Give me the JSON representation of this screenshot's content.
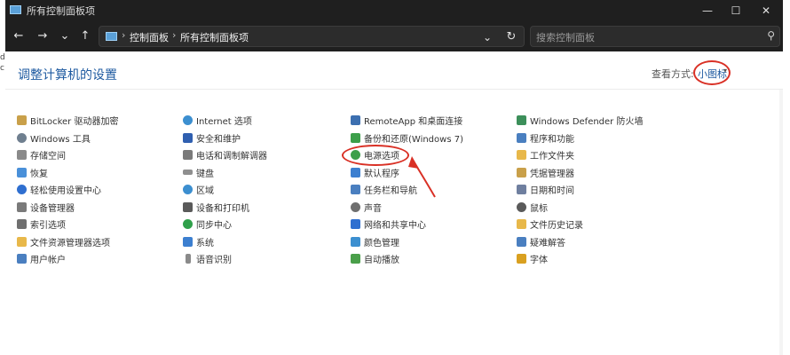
{
  "window": {
    "title": "所有控制面板项"
  },
  "titlebar": {
    "minimize": "—",
    "maximize": "☐",
    "close": "✕"
  },
  "nav": {
    "back": "←",
    "forward": "→",
    "recent": "⌄",
    "up": "↑",
    "dropdown": "⌄",
    "refresh": "↻"
  },
  "breadcrumb": {
    "sep": "›",
    "items": [
      "控制面板",
      "所有控制面板项"
    ]
  },
  "search": {
    "placeholder": "搜索控制面板",
    "icon": "⚲"
  },
  "content": {
    "title": "调整计算机的设置",
    "view_by_label": "查看方式:",
    "view_by_value": "小图标",
    "view_by_arrow": "▾"
  },
  "columns": [
    {
      "items": [
        {
          "label": "BitLocker 驱动器加密",
          "icon": "key-icon",
          "color": "#c9a04a"
        },
        {
          "label": "Windows 工具",
          "icon": "gear-icon",
          "color": "#6f7f8f"
        },
        {
          "label": "存储空间",
          "icon": "storage-icon",
          "color": "#8a8a8a"
        },
        {
          "label": "恢复",
          "icon": "recovery-icon",
          "color": "#4a90d9"
        },
        {
          "label": "轻松使用设置中心",
          "icon": "accessibility-icon",
          "color": "#2f6fd0"
        },
        {
          "label": "设备管理器",
          "icon": "device-manager-icon",
          "color": "#7a7a7a"
        },
        {
          "label": "索引选项",
          "icon": "index-icon",
          "color": "#6f6f6f"
        },
        {
          "label": "文件资源管理器选项",
          "icon": "folder-icon",
          "color": "#e8b84a"
        },
        {
          "label": "用户帐户",
          "icon": "users-icon",
          "color": "#4a7fc0"
        }
      ]
    },
    {
      "items": [
        {
          "label": "Internet 选项",
          "icon": "globe-icon",
          "color": "#3c8fd0"
        },
        {
          "label": "安全和维护",
          "icon": "flag-icon",
          "color": "#2f5fb0"
        },
        {
          "label": "电话和调制解调器",
          "icon": "phone-icon",
          "color": "#7a7a7a"
        },
        {
          "label": "键盘",
          "icon": "keyboard-icon",
          "color": "#8f8f8f"
        },
        {
          "label": "区域",
          "icon": "region-icon",
          "color": "#3c8fd0"
        },
        {
          "label": "设备和打印机",
          "icon": "printer-icon",
          "color": "#5a5a5a"
        },
        {
          "label": "同步中心",
          "icon": "sync-icon",
          "color": "#2fa04a"
        },
        {
          "label": "系统",
          "icon": "system-icon",
          "color": "#3c7fd0"
        },
        {
          "label": "语音识别",
          "icon": "microphone-icon",
          "color": "#8a8a8a"
        }
      ]
    },
    {
      "items": [
        {
          "label": "RemoteApp 和桌面连接",
          "icon": "remote-desktop-icon",
          "color": "#3c6fb0"
        },
        {
          "label": "备份和还原(Windows 7)",
          "icon": "backup-icon",
          "color": "#3c9f4a"
        },
        {
          "label": "电源选项",
          "icon": "power-icon",
          "color": "#3c9f4a"
        },
        {
          "label": "默认程序",
          "icon": "default-programs-icon",
          "color": "#3c7fd0"
        },
        {
          "label": "任务栏和导航",
          "icon": "taskbar-icon",
          "color": "#4a7fc0"
        },
        {
          "label": "声音",
          "icon": "speaker-icon",
          "color": "#6f6f6f"
        },
        {
          "label": "网络和共享中心",
          "icon": "network-icon",
          "color": "#2f6fd0"
        },
        {
          "label": "颜色管理",
          "icon": "color-icon",
          "color": "#3c8fd0"
        },
        {
          "label": "自动播放",
          "icon": "autoplay-icon",
          "color": "#4a9f4a"
        }
      ]
    },
    {
      "items": [
        {
          "label": "Windows Defender 防火墙",
          "icon": "firewall-icon",
          "color": "#3c8f5a"
        },
        {
          "label": "程序和功能",
          "icon": "programs-icon",
          "color": "#4a7fc0"
        },
        {
          "label": "工作文件夹",
          "icon": "work-folder-icon",
          "color": "#e8b84a"
        },
        {
          "label": "凭据管理器",
          "icon": "credential-icon",
          "color": "#c9a04a"
        },
        {
          "label": "日期和时间",
          "icon": "clock-icon",
          "color": "#6f7f9f"
        },
        {
          "label": "鼠标",
          "icon": "mouse-icon",
          "color": "#5a5a5a"
        },
        {
          "label": "文件历史记录",
          "icon": "file-history-icon",
          "color": "#e8b84a"
        },
        {
          "label": "疑难解答",
          "icon": "troubleshoot-icon",
          "color": "#4a7fc0"
        },
        {
          "label": "字体",
          "icon": "font-icon",
          "color": "#d9a020"
        }
      ]
    }
  ],
  "edge": {
    "left_top": "d",
    "left_bottom": "c"
  },
  "colors": {
    "annotation": "#d93025",
    "link": "#1e5aa0",
    "dark_chrome": "#1f1f1f"
  }
}
